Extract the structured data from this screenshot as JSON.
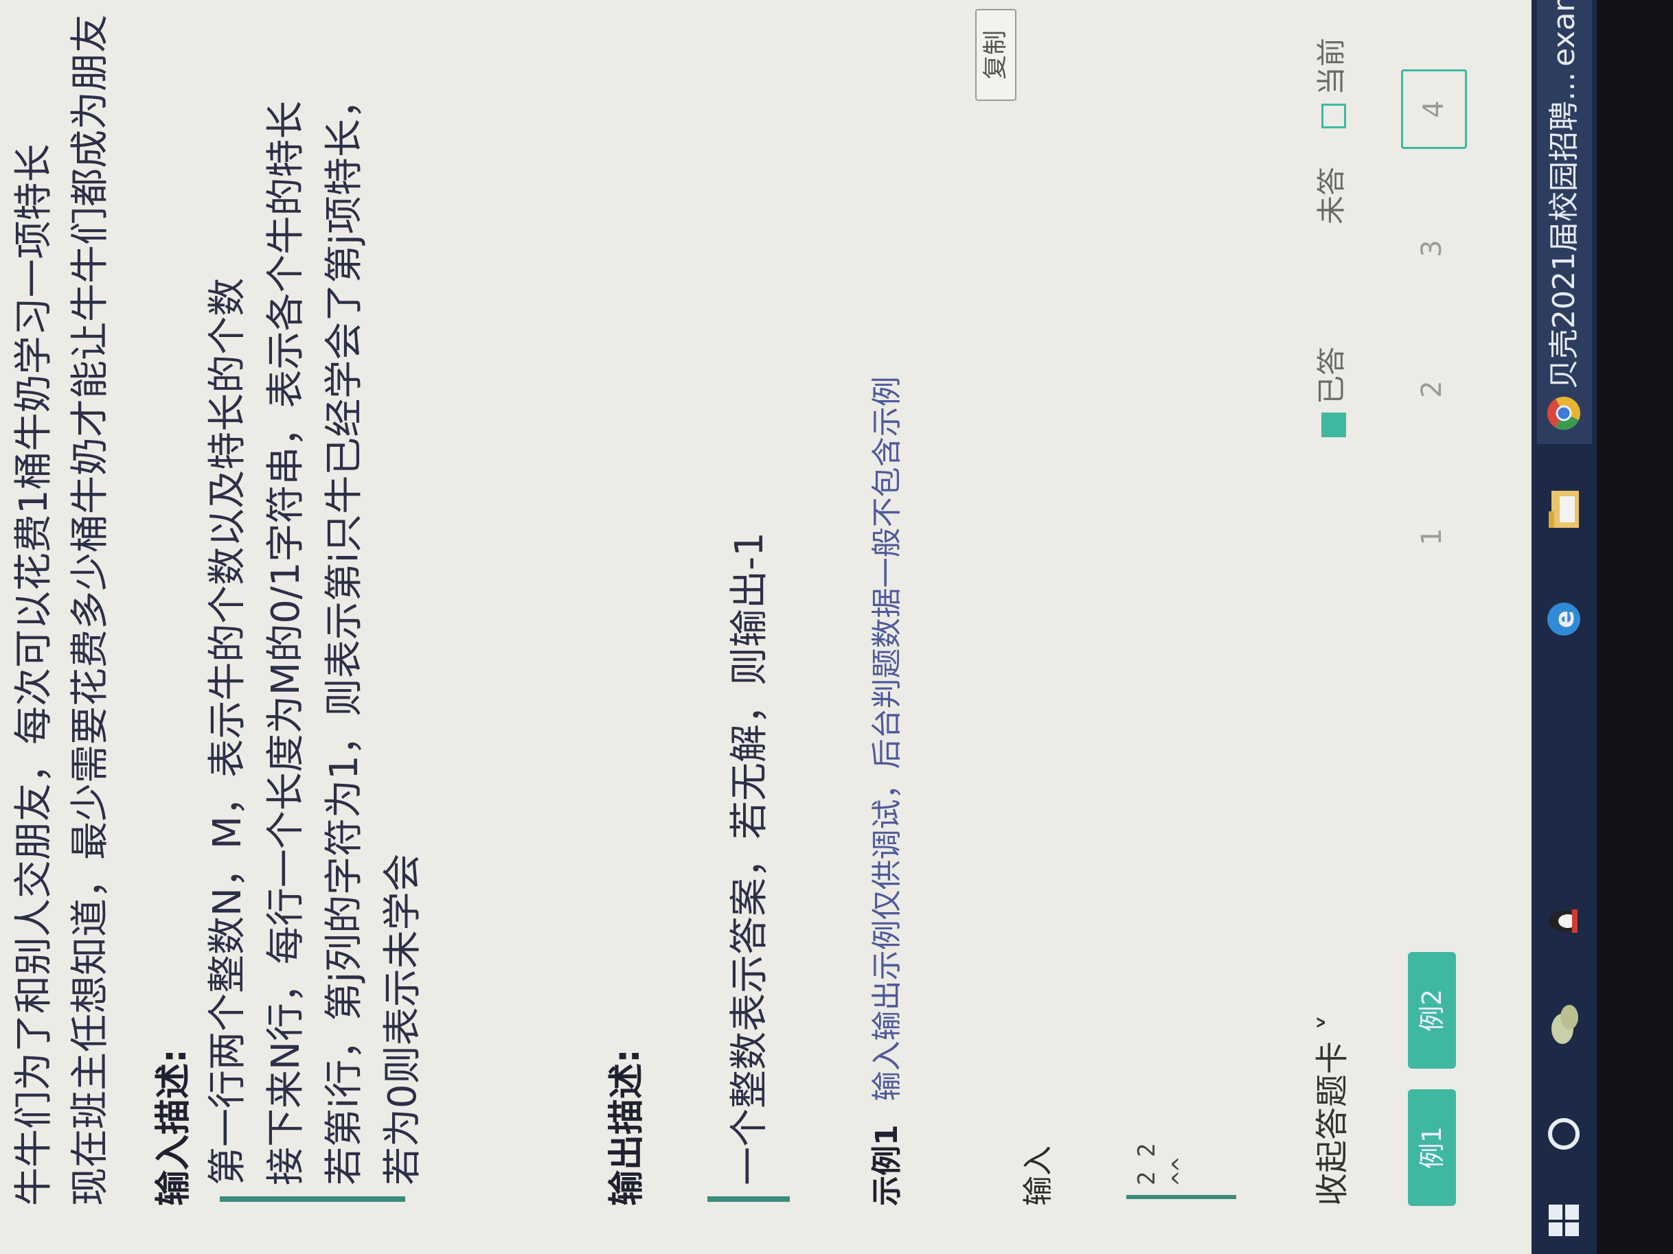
{
  "problem": {
    "intro_line1": "牛牛们为了和别人交朋友，每次可以花费1桶牛奶学习一项特长",
    "intro_line2": "现在班主任想知道，最少需要花费多少桶牛奶才能让牛牛们都成为朋友",
    "input_title": "输入描述:",
    "input_lines": [
      "第一行两个整数N，M，表示牛的个数以及特长的个数",
      "接下来N行，每行一个长度为M的0/1字符串，表示各个牛的特长",
      "若第i行，第j列的字符为1，则表示第i只牛已经学会了第j项特长，",
      "若为0则表示未学会"
    ],
    "output_title": "输出描述:",
    "output_lines": [
      "一个整数表示答案，若无解，则输出-1"
    ]
  },
  "example": {
    "title": "示例1",
    "note": "输入输出示例仅供调试，后台判题数据一般不包含示例",
    "copy_label": "复制",
    "input_label": "输入",
    "input_lines": [
      "2 2",
      "^^"
    ]
  },
  "answer_card": {
    "toggle_label": "收起答题卡 ˅",
    "legend_answered": "已答",
    "legend_unanswered": "未答",
    "legend_current": "当前",
    "tabs": [
      "例1",
      "例2"
    ],
    "question_numbers": [
      "1",
      "2",
      "3",
      "4"
    ],
    "current_question": "4"
  },
  "taskbar": {
    "icons": [
      "windows-start-icon",
      "cortana-circle-icon",
      "wechat-icon",
      "qq-penguin-icon",
      "edge-icon",
      "file-explorer-icon",
      "chrome-icon"
    ],
    "active_task": "贝壳2021届校园招聘...",
    "second_task": "exam.n"
  },
  "colors": {
    "accent": "#3fb8a2",
    "text": "#2c2f47",
    "note": "#4e5a9a",
    "taskbar": "#1c2a47"
  }
}
